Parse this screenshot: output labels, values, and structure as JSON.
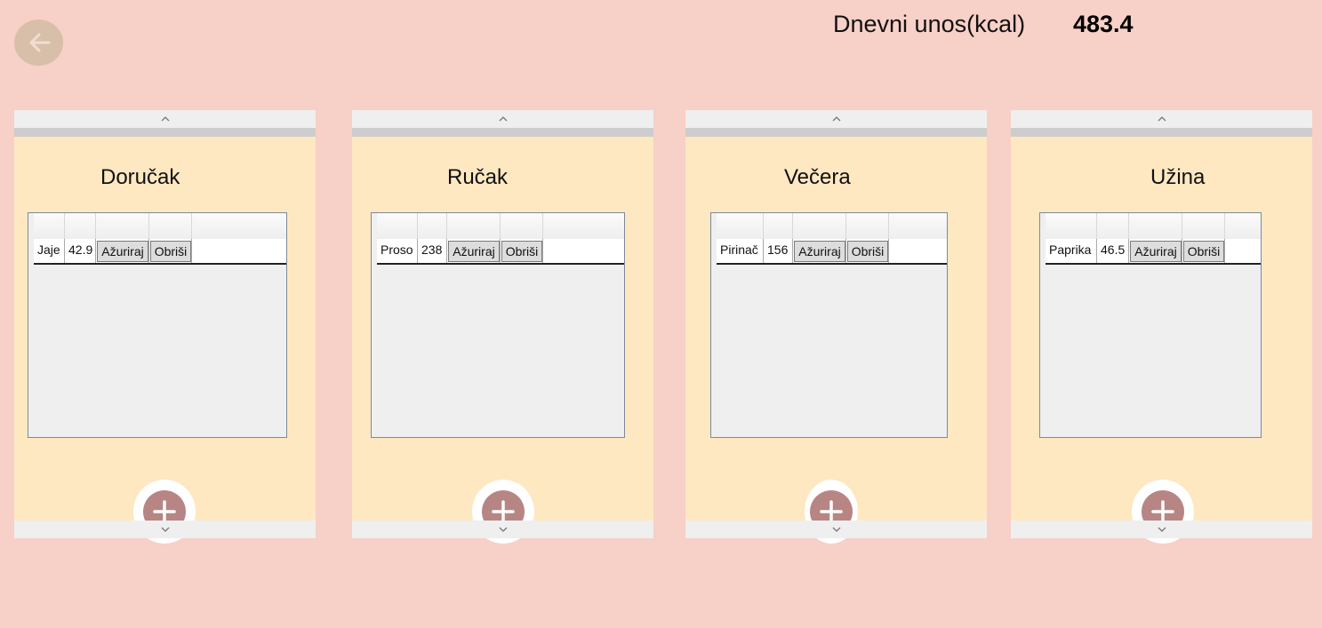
{
  "header": {
    "label": "Dnevni unos(kcal)",
    "value": "483.4"
  },
  "colors": {
    "background": "#f7d0c7",
    "panel": "#fde8c2",
    "back_button": "#d8bfaa",
    "add_button": "#b88585"
  },
  "icons": {
    "back": "arrow-left-icon",
    "add": "plus-icon",
    "scroll_up": "chevron-up-icon",
    "scroll_down": "chevron-down-icon"
  },
  "meals": [
    {
      "title": "Doručak",
      "rows": [
        {
          "name": "Jaje",
          "kcal": "42.9",
          "update": "Ažuriraj",
          "delete": "Obriši"
        }
      ]
    },
    {
      "title": "Ručak",
      "rows": [
        {
          "name": "Proso",
          "kcal": "238",
          "update": "Ažuriraj",
          "delete": "Obriši"
        }
      ]
    },
    {
      "title": "Večera",
      "rows": [
        {
          "name": "Pirinač",
          "kcal": "156",
          "update": "Ažuriraj",
          "delete": "Obriši"
        }
      ]
    },
    {
      "title": "Užina",
      "rows": [
        {
          "name": "Paprika",
          "kcal": "46.5",
          "update": "Ažuriraj",
          "delete": "Obriši"
        }
      ]
    }
  ]
}
